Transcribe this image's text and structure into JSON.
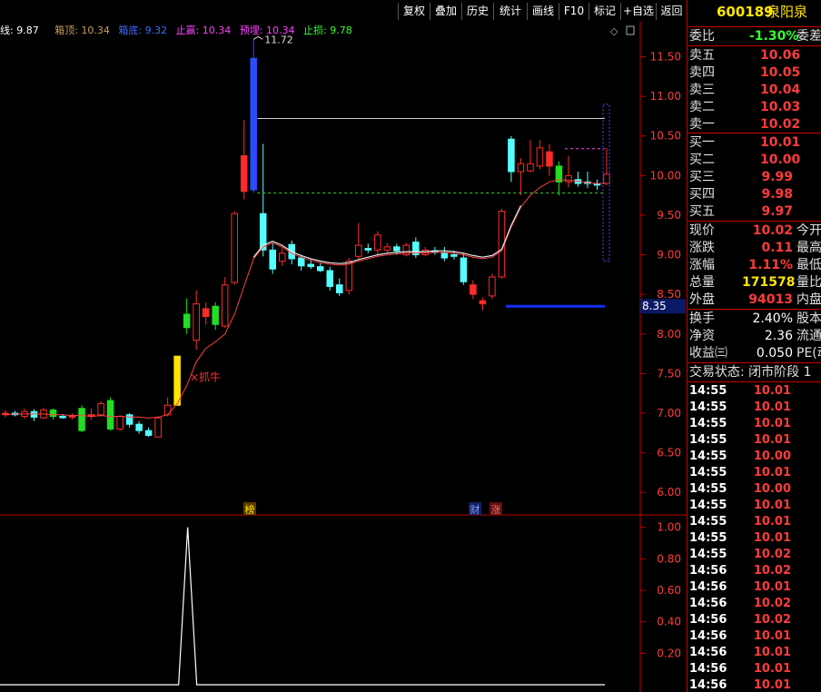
{
  "toolbar": {
    "buttons": [
      "复权",
      "叠加",
      "历史",
      "统计",
      "画线",
      "F10",
      "标记",
      "+自选",
      "返回"
    ]
  },
  "legend": {
    "ma_label": "线: 9.87",
    "box_top": "箱顶: 10.34",
    "box_bottom": "箱底: 9.32",
    "profit_target": "止赢: 10.34",
    "expected": "预埋: 10.34",
    "stop_loss": "止损: 9.78"
  },
  "annotations": {
    "high_label": "11.72",
    "signal_label": "×抓牛",
    "current_price_marker": "8.35",
    "event_tags": [
      "榜",
      "财",
      "涨"
    ]
  },
  "colors": {
    "up": "#ff2a2a",
    "down": "#54ffff",
    "green": "#22dd22",
    "blue": "#2a4cff",
    "yellow": "#ffe600",
    "ma": "#ff4040",
    "axis": "#c00000"
  },
  "chart_data": [
    {
      "type": "candlestick",
      "title": "",
      "ylim": [
        5.75,
        11.85
      ],
      "y_ticks": [
        6.0,
        6.5,
        7.0,
        7.5,
        8.0,
        8.5,
        9.0,
        9.5,
        10.0,
        10.5,
        11.0,
        11.5
      ],
      "candles": [
        {
          "o": 6.98,
          "c": 7.0,
          "h": 7.04,
          "l": 6.95,
          "s": "up"
        },
        {
          "o": 7.0,
          "c": 6.98,
          "h": 7.03,
          "l": 6.96,
          "s": "down"
        },
        {
          "o": 6.96,
          "c": 7.02,
          "h": 7.06,
          "l": 6.93,
          "s": "up"
        },
        {
          "o": 7.02,
          "c": 6.95,
          "h": 7.05,
          "l": 6.9,
          "s": "down"
        },
        {
          "o": 6.94,
          "c": 7.04,
          "h": 7.07,
          "l": 6.93,
          "s": "up"
        },
        {
          "o": 7.04,
          "c": 6.96,
          "h": 7.06,
          "l": 6.92,
          "s": "green"
        },
        {
          "o": 6.96,
          "c": 6.95,
          "h": 6.99,
          "l": 6.93,
          "s": "down"
        },
        {
          "o": 6.95,
          "c": 6.97,
          "h": 7.0,
          "l": 6.92,
          "s": "up"
        },
        {
          "o": 7.06,
          "c": 6.78,
          "h": 7.1,
          "l": 6.76,
          "s": "green"
        },
        {
          "o": 6.98,
          "c": 6.96,
          "h": 7.06,
          "l": 6.92,
          "s": "up"
        },
        {
          "o": 6.98,
          "c": 7.12,
          "h": 7.15,
          "l": 6.96,
          "s": "up"
        },
        {
          "o": 7.16,
          "c": 6.8,
          "h": 7.2,
          "l": 6.78,
          "s": "green"
        },
        {
          "o": 6.8,
          "c": 6.96,
          "h": 6.98,
          "l": 6.78,
          "s": "up"
        },
        {
          "o": 6.98,
          "c": 6.86,
          "h": 7.0,
          "l": 6.82,
          "s": "down"
        },
        {
          "o": 6.86,
          "c": 6.78,
          "h": 6.9,
          "l": 6.74,
          "s": "down"
        },
        {
          "o": 6.78,
          "c": 6.72,
          "h": 6.82,
          "l": 6.7,
          "s": "down"
        },
        {
          "o": 6.7,
          "c": 6.94,
          "h": 6.96,
          "l": 6.7,
          "s": "up"
        },
        {
          "o": 6.98,
          "c": 7.1,
          "h": 7.2,
          "l": 6.96,
          "s": "up"
        },
        {
          "o": 7.1,
          "c": 7.72,
          "h": 7.72,
          "l": 7.1,
          "s": "yellow"
        },
        {
          "o": 8.08,
          "c": 8.25,
          "h": 8.45,
          "l": 8.0,
          "s": "green"
        },
        {
          "o": 7.92,
          "c": 8.38,
          "h": 8.55,
          "l": 7.8,
          "s": "up"
        },
        {
          "o": 8.32,
          "c": 8.22,
          "h": 8.4,
          "l": 8.12,
          "s": "up"
        },
        {
          "o": 8.35,
          "c": 8.12,
          "h": 8.4,
          "l": 8.05,
          "s": "green"
        },
        {
          "o": 8.1,
          "c": 8.62,
          "h": 8.72,
          "l": 8.08,
          "s": "up"
        },
        {
          "o": 8.65,
          "c": 9.52,
          "h": 9.55,
          "l": 8.62,
          "s": "up"
        },
        {
          "o": 10.25,
          "c": 9.8,
          "h": 10.7,
          "l": 9.7,
          "s": "up"
        },
        {
          "o": 9.82,
          "c": 11.48,
          "h": 11.72,
          "l": 9.78,
          "s": "blue"
        },
        {
          "o": 9.52,
          "c": 9.06,
          "h": 10.4,
          "l": 8.98,
          "s": "down"
        },
        {
          "o": 9.06,
          "c": 8.82,
          "h": 9.15,
          "l": 8.76,
          "s": "down"
        },
        {
          "o": 8.92,
          "c": 9.02,
          "h": 9.1,
          "l": 8.86,
          "s": "up"
        },
        {
          "o": 9.13,
          "c": 8.95,
          "h": 9.18,
          "l": 8.88,
          "s": "down"
        },
        {
          "o": 8.96,
          "c": 8.86,
          "h": 9.0,
          "l": 8.8,
          "s": "down"
        },
        {
          "o": 8.88,
          "c": 8.85,
          "h": 8.94,
          "l": 8.82,
          "s": "down"
        },
        {
          "o": 8.85,
          "c": 8.8,
          "h": 8.9,
          "l": 8.78,
          "s": "down"
        },
        {
          "o": 8.8,
          "c": 8.6,
          "h": 8.85,
          "l": 8.55,
          "s": "down"
        },
        {
          "o": 8.62,
          "c": 8.52,
          "h": 8.7,
          "l": 8.48,
          "s": "down"
        },
        {
          "o": 8.55,
          "c": 8.92,
          "h": 8.96,
          "l": 8.5,
          "s": "up"
        },
        {
          "o": 8.98,
          "c": 9.12,
          "h": 9.4,
          "l": 8.95,
          "s": "up"
        },
        {
          "o": 9.08,
          "c": 9.06,
          "h": 9.14,
          "l": 9.02,
          "s": "down"
        },
        {
          "o": 9.06,
          "c": 9.25,
          "h": 9.3,
          "l": 9.0,
          "s": "up"
        },
        {
          "o": 9.06,
          "c": 9.1,
          "h": 9.15,
          "l": 9.02,
          "s": "up"
        },
        {
          "o": 9.1,
          "c": 9.05,
          "h": 9.14,
          "l": 9.0,
          "s": "down"
        },
        {
          "o": 9.0,
          "c": 9.12,
          "h": 9.15,
          "l": 8.98,
          "s": "up"
        },
        {
          "o": 9.16,
          "c": 9.0,
          "h": 9.22,
          "l": 8.96,
          "s": "down"
        },
        {
          "o": 9.0,
          "c": 9.06,
          "h": 9.1,
          "l": 8.98,
          "s": "up"
        },
        {
          "o": 9.05,
          "c": 9.03,
          "h": 9.1,
          "l": 9.0,
          "s": "down"
        },
        {
          "o": 9.03,
          "c": 8.96,
          "h": 9.1,
          "l": 8.92,
          "s": "down"
        },
        {
          "o": 9.0,
          "c": 8.98,
          "h": 9.05,
          "l": 8.94,
          "s": "down"
        },
        {
          "o": 8.96,
          "c": 8.66,
          "h": 9.02,
          "l": 8.62,
          "s": "down"
        },
        {
          "o": 8.62,
          "c": 8.5,
          "h": 8.68,
          "l": 8.44,
          "s": "up"
        },
        {
          "o": 8.42,
          "c": 8.38,
          "h": 8.46,
          "l": 8.3,
          "s": "up"
        },
        {
          "o": 8.48,
          "c": 8.72,
          "h": 8.76,
          "l": 8.44,
          "s": "up"
        },
        {
          "o": 8.72,
          "c": 9.55,
          "h": 9.58,
          "l": 8.7,
          "s": "up"
        },
        {
          "o": 10.46,
          "c": 10.05,
          "h": 10.5,
          "l": 9.92,
          "s": "down"
        },
        {
          "o": 10.05,
          "c": 10.15,
          "h": 10.22,
          "l": 9.75,
          "s": "up"
        },
        {
          "o": 10.06,
          "c": 10.15,
          "h": 10.45,
          "l": 10.04,
          "s": "up"
        },
        {
          "o": 10.12,
          "c": 10.35,
          "h": 10.45,
          "l": 10.08,
          "s": "up"
        },
        {
          "o": 10.3,
          "c": 10.12,
          "h": 10.4,
          "l": 10.0,
          "s": "up"
        },
        {
          "o": 10.12,
          "c": 9.92,
          "h": 10.18,
          "l": 9.75,
          "s": "green"
        },
        {
          "o": 9.92,
          "c": 10.0,
          "h": 10.25,
          "l": 9.85,
          "s": "up"
        },
        {
          "o": 9.95,
          "c": 9.9,
          "h": 10.05,
          "l": 9.86,
          "s": "down"
        },
        {
          "o": 9.92,
          "c": 9.9,
          "h": 10.05,
          "l": 9.84,
          "s": "down"
        },
        {
          "o": 9.9,
          "c": 9.88,
          "h": 9.95,
          "l": 9.82,
          "s": "down"
        },
        {
          "o": 9.9,
          "c": 10.02,
          "h": 10.35,
          "l": 9.88,
          "s": "up"
        }
      ],
      "ma_values": [
        6.98,
        6.99,
        6.99,
        6.99,
        6.99,
        6.98,
        6.98,
        6.97,
        6.97,
        6.96,
        6.97,
        6.96,
        6.96,
        6.95,
        6.95,
        6.94,
        6.95,
        6.98,
        7.12,
        7.35,
        7.65,
        7.82,
        7.9,
        8.0,
        8.25,
        8.6,
        8.95,
        9.1,
        9.15,
        9.1,
        9.02,
        8.97,
        8.93,
        8.9,
        8.88,
        8.87,
        8.88,
        8.92,
        8.95,
        8.98,
        9.0,
        9.01,
        9.02,
        9.02,
        9.02,
        9.03,
        9.03,
        9.02,
        9.0,
        8.97,
        8.95,
        8.97,
        9.05,
        9.35,
        9.6,
        9.75,
        9.85,
        9.92,
        9.95,
        9.94,
        9.93,
        9.91,
        9.9,
        9.9
      ],
      "levels": {
        "box_top": 10.72,
        "stop_loss": 9.78,
        "target": 10.34,
        "blue_line": 8.35
      }
    },
    {
      "type": "line",
      "ylim": [
        0,
        1.05
      ],
      "y_ticks": [
        0.2,
        0.4,
        0.6,
        0.8,
        1.0
      ],
      "peak_index": 19,
      "values_desc": "zero everywhere except a spike to 1.00 at the signal bar"
    }
  ],
  "panel": {
    "stock_code": "600189",
    "stock_name": "泉阳泉",
    "wei_bi": {
      "label": "委比",
      "value": "-1.30%",
      "ext": "委差"
    },
    "asks": [
      {
        "label": "卖五",
        "price": "10.06"
      },
      {
        "label": "卖四",
        "price": "10.05"
      },
      {
        "label": "卖三",
        "price": "10.04"
      },
      {
        "label": "卖二",
        "price": "10.03"
      },
      {
        "label": "卖一",
        "price": "10.02"
      }
    ],
    "bids": [
      {
        "label": "买一",
        "price": "10.01"
      },
      {
        "label": "买二",
        "price": "10.00"
      },
      {
        "label": "买三",
        "price": "9.99"
      },
      {
        "label": "买四",
        "price": "9.98"
      },
      {
        "label": "买五",
        "price": "9.97"
      }
    ],
    "quote": [
      {
        "label": "现价",
        "value": "10.02",
        "ext": "今开",
        "color": "#ff3b3b"
      },
      {
        "label": "涨跌",
        "value": "0.11",
        "ext": "最高",
        "color": "#ff3b3b"
      },
      {
        "label": "涨幅",
        "value": "1.11%",
        "ext": "最低",
        "color": "#ff3b3b"
      },
      {
        "label": "总量",
        "value": "171578",
        "ext": "量比",
        "color": "#ffe600"
      },
      {
        "label": "外盘",
        "value": "94013",
        "ext": "内盘",
        "color": "#ff3b3b"
      }
    ],
    "fundamentals": [
      {
        "label": "换手",
        "value": "2.40%",
        "ext": "股本"
      },
      {
        "label": "净资",
        "value": "2.36",
        "ext": "流通"
      },
      {
        "label": "收益㈢",
        "value": "0.050",
        "ext": "PE(动"
      }
    ],
    "trade_status": "交易状态: 闭市阶段 1",
    "ticks": [
      {
        "time": "14:55",
        "price": "10.01"
      },
      {
        "time": "14:55",
        "price": "10.01"
      },
      {
        "time": "14:55",
        "price": "10.01"
      },
      {
        "time": "14:55",
        "price": "10.01"
      },
      {
        "time": "14:55",
        "price": "10.00"
      },
      {
        "time": "14:55",
        "price": "10.01"
      },
      {
        "time": "14:55",
        "price": "10.00"
      },
      {
        "time": "14:55",
        "price": "10.01"
      },
      {
        "time": "14:55",
        "price": "10.01"
      },
      {
        "time": "14:55",
        "price": "10.01"
      },
      {
        "time": "14:55",
        "price": "10.02"
      },
      {
        "time": "14:56",
        "price": "10.02"
      },
      {
        "time": "14:56",
        "price": "10.01"
      },
      {
        "time": "14:56",
        "price": "10.02"
      },
      {
        "time": "14:56",
        "price": "10.02"
      },
      {
        "time": "14:56",
        "price": "10.01"
      },
      {
        "time": "14:56",
        "price": "10.01"
      },
      {
        "time": "14:56",
        "price": "10.01"
      },
      {
        "time": "14:56",
        "price": "10.01"
      }
    ]
  }
}
